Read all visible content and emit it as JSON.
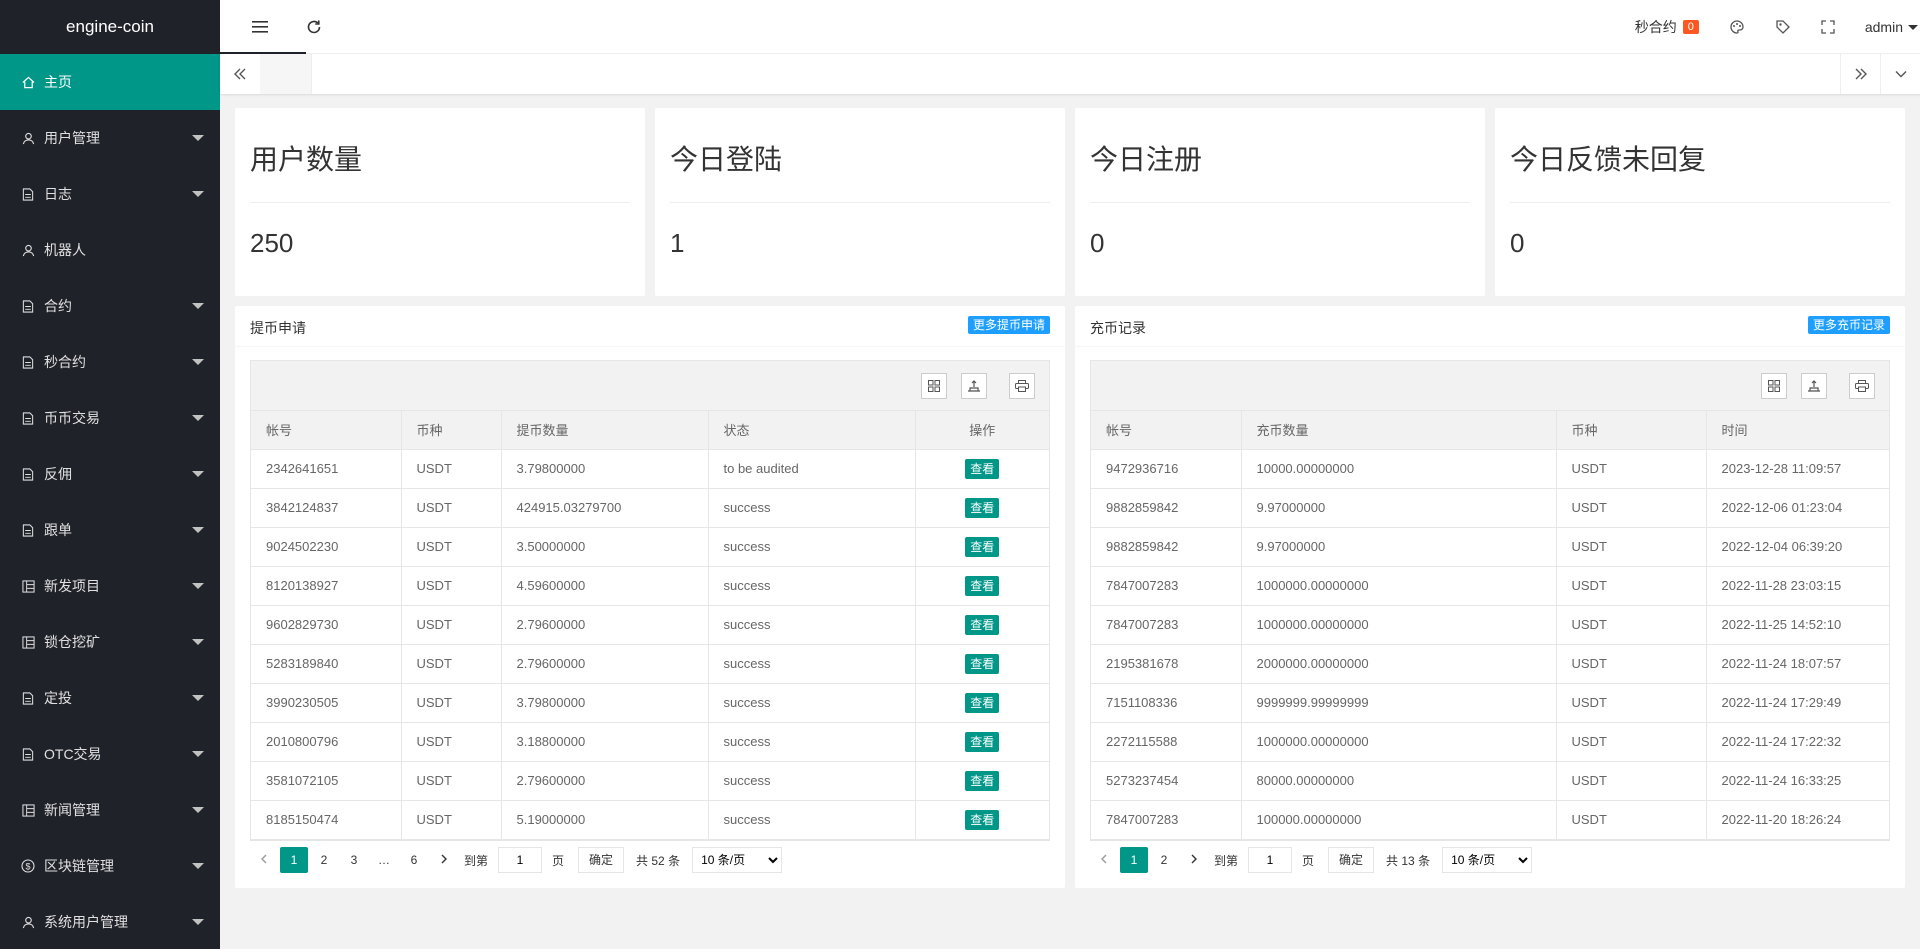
{
  "app": {
    "logo": "engine-coin"
  },
  "sidebar": {
    "items": [
      {
        "label": "主页",
        "icon": "home-icon",
        "active": true,
        "caret": false
      },
      {
        "label": "用户管理",
        "icon": "user-icon",
        "caret": true
      },
      {
        "label": "日志",
        "icon": "file-icon",
        "caret": true
      },
      {
        "label": "机器人",
        "icon": "user-icon",
        "caret": false
      },
      {
        "label": "合约",
        "icon": "file-icon",
        "caret": true
      },
      {
        "label": "秒合约",
        "icon": "file-icon",
        "caret": true
      },
      {
        "label": "币币交易",
        "icon": "file-icon",
        "caret": true
      },
      {
        "label": "反佣",
        "icon": "file-icon",
        "caret": true
      },
      {
        "label": "跟单",
        "icon": "file-icon",
        "caret": true
      },
      {
        "label": "新发项目",
        "icon": "template-icon",
        "caret": true
      },
      {
        "label": "锁仓挖矿",
        "icon": "template-icon",
        "caret": true
      },
      {
        "label": "定投",
        "icon": "file-icon",
        "caret": true
      },
      {
        "label": "OTC交易",
        "icon": "file-icon",
        "caret": true
      },
      {
        "label": "新闻管理",
        "icon": "template-icon",
        "caret": true
      },
      {
        "label": "区块链管理",
        "icon": "dollar-icon",
        "caret": true
      },
      {
        "label": "系统用户管理",
        "icon": "user-icon",
        "caret": true
      }
    ]
  },
  "header": {
    "second_contract_label": "秒合约",
    "second_contract_count": "0",
    "user": "admin"
  },
  "stats": [
    {
      "title": "用户数量",
      "value": "250"
    },
    {
      "title": "今日登陆",
      "value": "1"
    },
    {
      "title": "今日注册",
      "value": "0"
    },
    {
      "title": "今日反馈未回复",
      "value": "0"
    }
  ],
  "withdraw": {
    "title": "提币申请",
    "more": "更多提币申请",
    "columns": [
      "帐号",
      "币种",
      "提币数量",
      "状态",
      "操作"
    ],
    "action_label": "查看",
    "rows": [
      [
        "2342641651",
        "USDT",
        "3.79800000",
        "to be audited"
      ],
      [
        "3842124837",
        "USDT",
        "424915.03279700",
        "success"
      ],
      [
        "9024502230",
        "USDT",
        "3.50000000",
        "success"
      ],
      [
        "8120138927",
        "USDT",
        "4.59600000",
        "success"
      ],
      [
        "9602829730",
        "USDT",
        "2.79600000",
        "success"
      ],
      [
        "5283189840",
        "USDT",
        "2.79600000",
        "success"
      ],
      [
        "3990230505",
        "USDT",
        "3.79800000",
        "success"
      ],
      [
        "2010800796",
        "USDT",
        "3.18800000",
        "success"
      ],
      [
        "3581072105",
        "USDT",
        "2.79600000",
        "success"
      ],
      [
        "8185150474",
        "USDT",
        "5.19000000",
        "success"
      ]
    ],
    "pager": {
      "pages": [
        "1",
        "2",
        "3",
        "…",
        "6"
      ],
      "goto": "到第",
      "page_value": "1",
      "page_unit": "页",
      "confirm": "确定",
      "total": "共 52 条",
      "size": "10 条/页"
    }
  },
  "recharge": {
    "title": "充币记录",
    "more": "更多充币记录",
    "columns": [
      "帐号",
      "充币数量",
      "币种",
      "时间"
    ],
    "rows": [
      [
        "9472936716",
        "10000.00000000",
        "USDT",
        "2023-12-28 11:09:57"
      ],
      [
        "9882859842",
        "9.97000000",
        "USDT",
        "2022-12-06 01:23:04"
      ],
      [
        "9882859842",
        "9.97000000",
        "USDT",
        "2022-12-04 06:39:20"
      ],
      [
        "7847007283",
        "1000000.00000000",
        "USDT",
        "2022-11-28 23:03:15"
      ],
      [
        "7847007283",
        "1000000.00000000",
        "USDT",
        "2022-11-25 14:52:10"
      ],
      [
        "2195381678",
        "2000000.00000000",
        "USDT",
        "2022-11-24 18:07:57"
      ],
      [
        "7151108336",
        "9999999.99999999",
        "USDT",
        "2022-11-24 17:29:49"
      ],
      [
        "2272115588",
        "1000000.00000000",
        "USDT",
        "2022-11-24 17:22:32"
      ],
      [
        "5273237454",
        "80000.00000000",
        "USDT",
        "2022-11-24 16:33:25"
      ],
      [
        "7847007283",
        "100000.00000000",
        "USDT",
        "2022-11-20 18:26:24"
      ]
    ],
    "pager": {
      "pages": [
        "1",
        "2"
      ],
      "goto": "到第",
      "page_value": "1",
      "page_unit": "页",
      "confirm": "确定",
      "total": "共 13 条",
      "size": "10 条/页"
    }
  },
  "colors": {
    "primary": "#009688",
    "sidebar": "#20222a",
    "blue": "#1e9fff",
    "badge": "#ff5722"
  }
}
